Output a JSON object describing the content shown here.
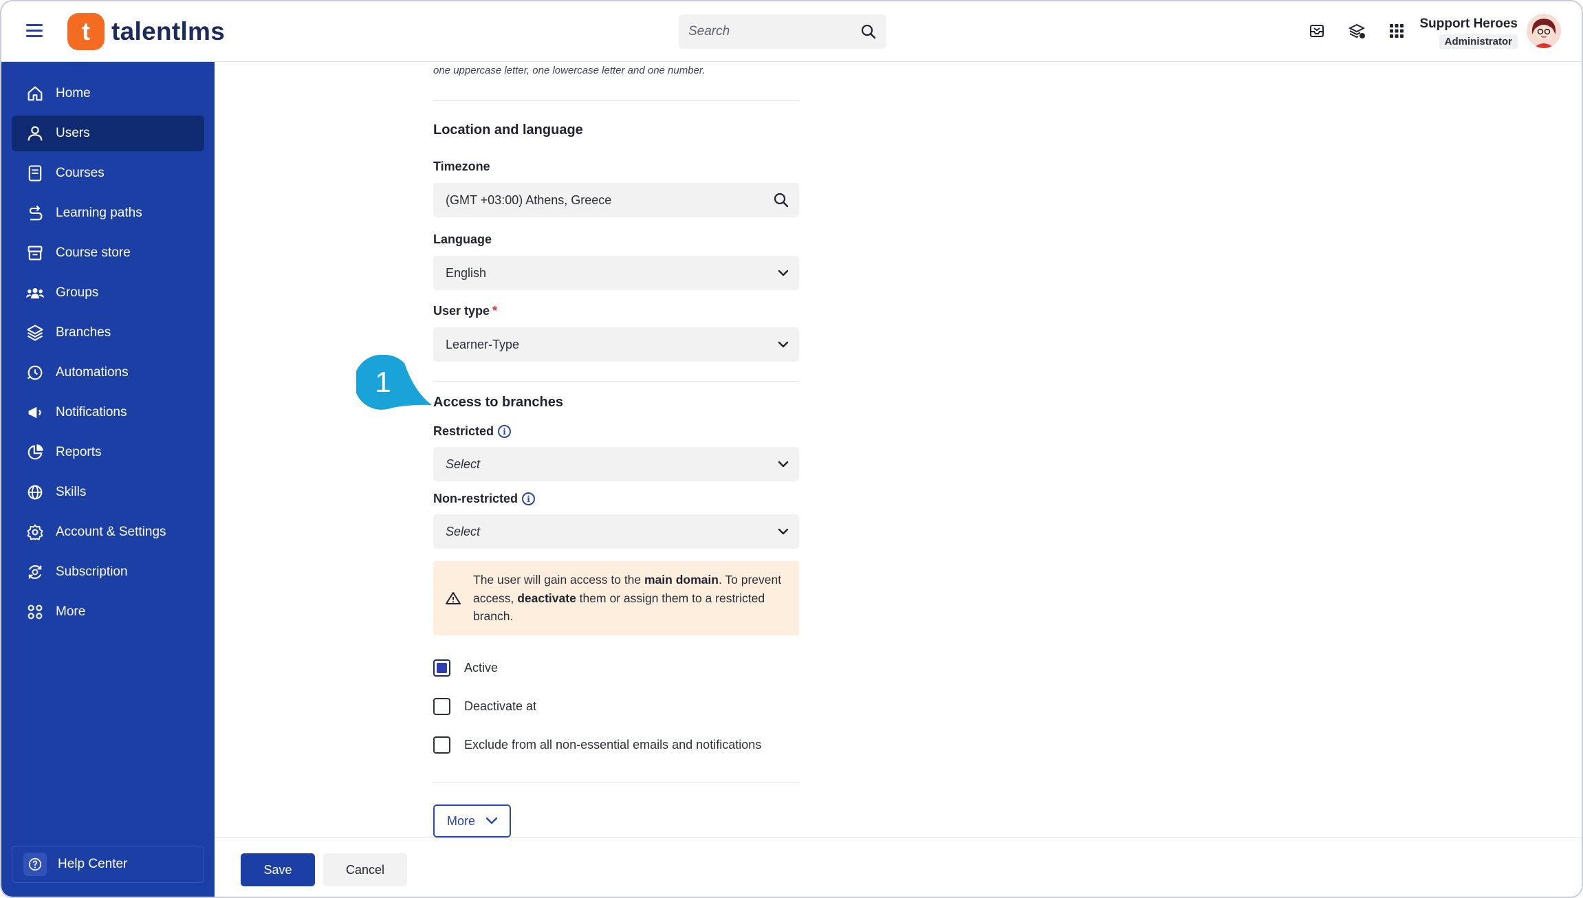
{
  "app": {
    "brand": "talentlms",
    "logo_glyph": "t"
  },
  "header": {
    "search_placeholder": "Search",
    "user_name": "Support Heroes",
    "user_role": "Administrator",
    "icons": [
      "inbox-icon",
      "discount-stack-icon",
      "apps-grid-icon"
    ]
  },
  "sidebar": {
    "items": [
      {
        "label": "Home",
        "icon": "home-icon"
      },
      {
        "label": "Users",
        "icon": "user-icon",
        "active": true
      },
      {
        "label": "Courses",
        "icon": "book-icon"
      },
      {
        "label": "Learning paths",
        "icon": "path-icon"
      },
      {
        "label": "Course store",
        "icon": "store-icon"
      },
      {
        "label": "Groups",
        "icon": "groups-icon"
      },
      {
        "label": "Branches",
        "icon": "layers-icon"
      },
      {
        "label": "Automations",
        "icon": "automation-icon"
      },
      {
        "label": "Notifications",
        "icon": "megaphone-icon"
      },
      {
        "label": "Reports",
        "icon": "pie-chart-icon"
      },
      {
        "label": "Skills",
        "icon": "globe-icon"
      },
      {
        "label": "Account & Settings",
        "icon": "gear-icon"
      },
      {
        "label": "Subscription",
        "icon": "subscription-icon"
      },
      {
        "label": "More",
        "icon": "dots-grid-icon"
      }
    ],
    "help_label": "Help Center"
  },
  "form": {
    "password_hint": "one uppercase letter, one lowercase letter and one number.",
    "location_title": "Location and language",
    "timezone_label": "Timezone",
    "timezone_value": "(GMT +03:00) Athens, Greece",
    "language_label": "Language",
    "language_value": "English",
    "user_type_label": "User type",
    "user_type_required": "*",
    "user_type_value": "Learner-Type",
    "branches_title": "Access to branches",
    "restricted_label": "Restricted",
    "restricted_value": "Select",
    "nonrestricted_label": "Non-restricted",
    "nonrestricted_value": "Select",
    "notice": {
      "part1": "The user will gain access to the ",
      "bold1": "main domain",
      "part2": ". To prevent access, ",
      "bold2": "deactivate",
      "part3": " them or assign them to a restricted branch."
    },
    "active_label": "Active",
    "active_checked": true,
    "deactivate_label": "Deactivate at",
    "deactivate_checked": false,
    "exclude_label": "Exclude from all non-essential emails and notifications",
    "exclude_checked": false,
    "more_label": "More"
  },
  "footer": {
    "save_label": "Save",
    "cancel_label": "Cancel"
  },
  "callout": {
    "number": "1",
    "color": "#1aa3d9"
  },
  "colors": {
    "sidebar": "#1c3fa5",
    "sidebar_active": "#0f2a70",
    "brand_orange": "#f36c21",
    "primary": "#1c3fa5"
  }
}
